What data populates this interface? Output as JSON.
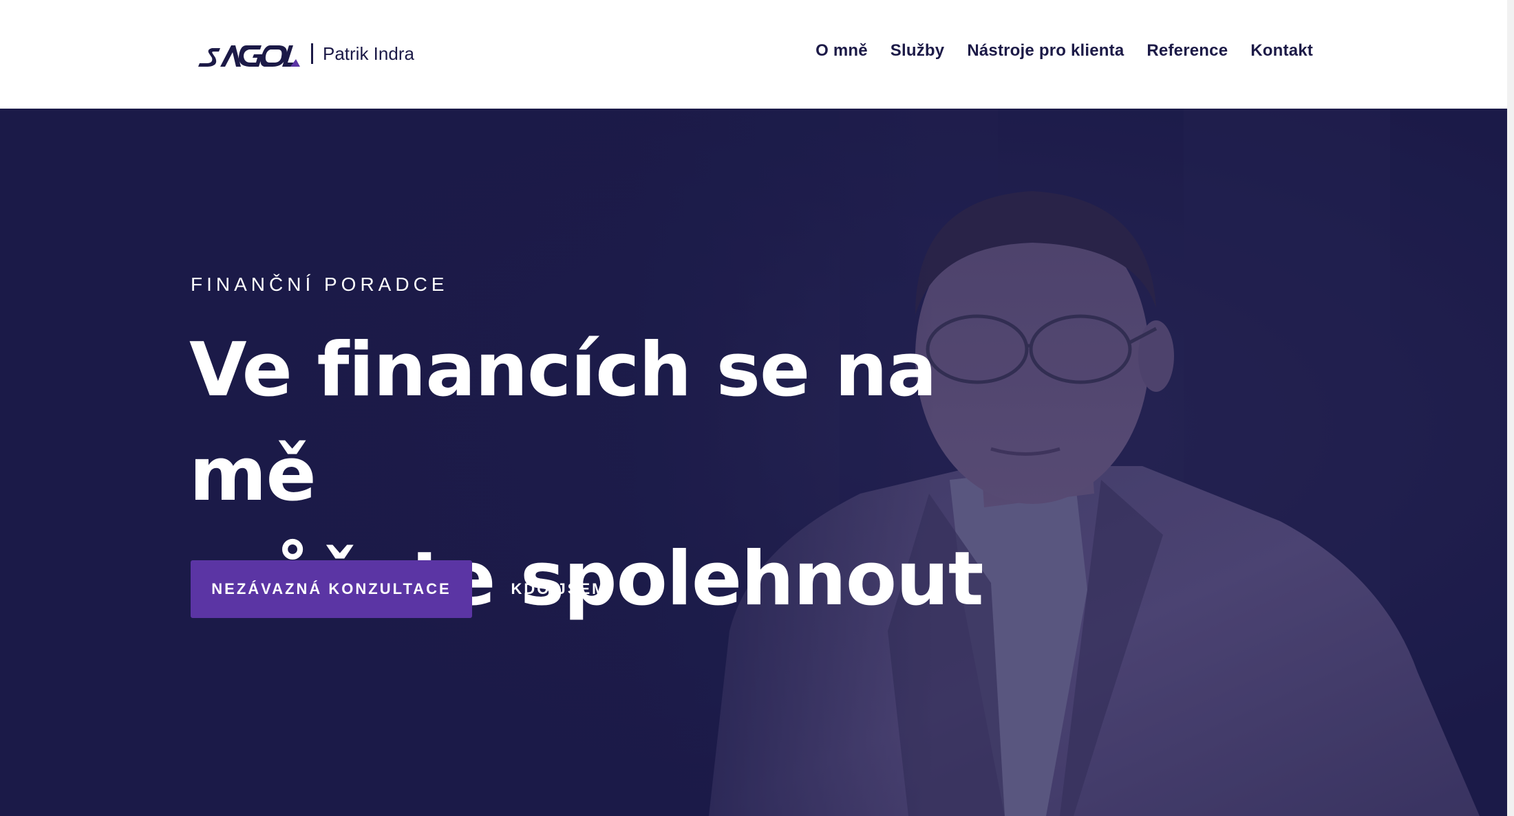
{
  "header": {
    "logo_name": "Patrik Indra",
    "logo_brand": "SAGOL",
    "nav": [
      {
        "label": "O mně"
      },
      {
        "label": "Služby"
      },
      {
        "label": "Nástroje pro klienta"
      },
      {
        "label": "Reference"
      },
      {
        "label": "Kontakt"
      }
    ]
  },
  "hero": {
    "eyebrow": "FINANČNÍ PORADCE",
    "headline_line1": "Ve financích se na mě",
    "headline_line2": "můžete spolehnout",
    "primary_button": "NEZÁVAZNÁ KONZULTACE",
    "secondary_button": "KDO JSEM",
    "photo": "portrait of a man in glasses and grey suit"
  },
  "colors": {
    "navy": "#1b1a49",
    "accent_purple": "#5b35a4",
    "nav_text": "#1c1a47",
    "white": "#ffffff"
  }
}
